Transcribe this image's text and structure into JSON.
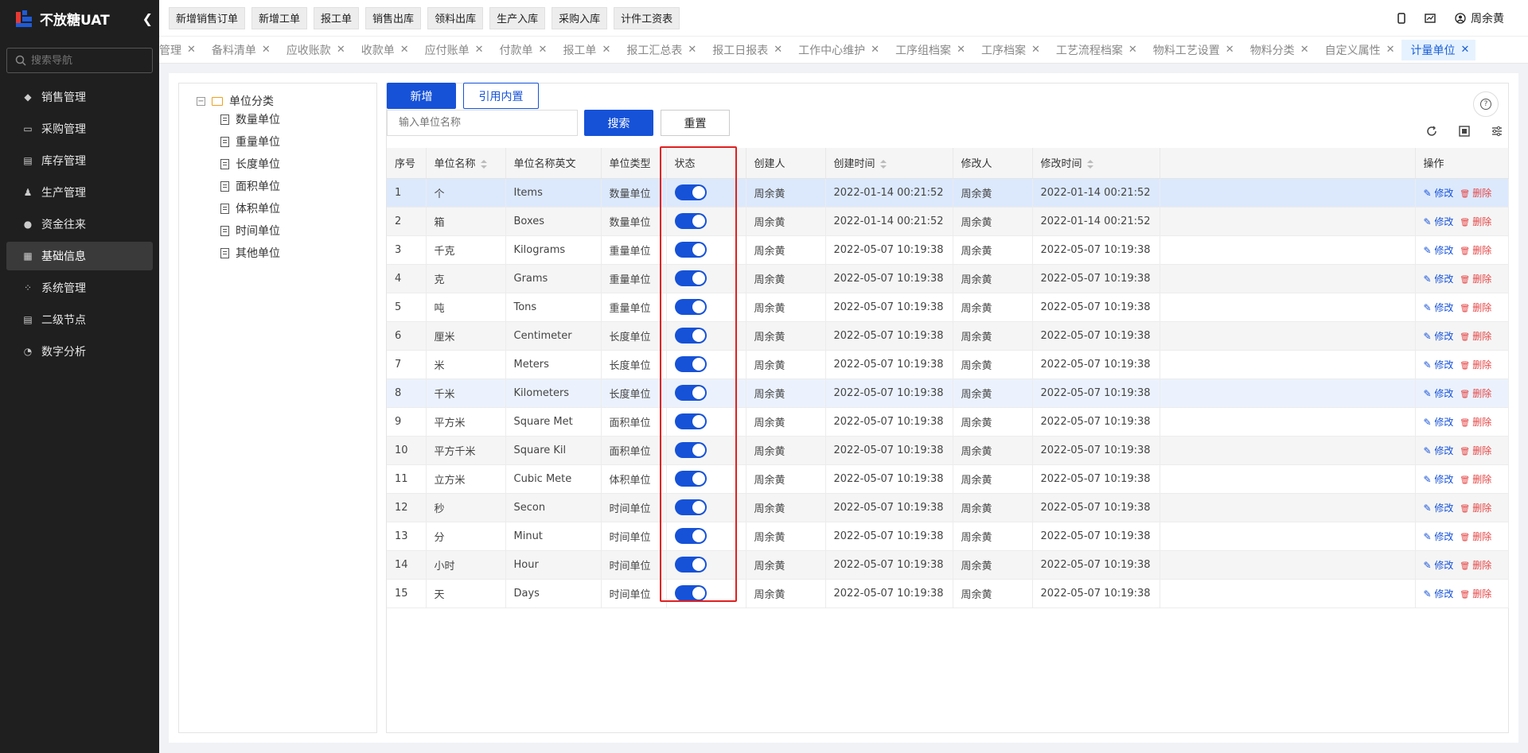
{
  "sidebar": {
    "logo_text": "不放糖UAT",
    "search_placeholder": "搜索导航",
    "items": [
      {
        "label": "销售管理",
        "icon": "tag-icon"
      },
      {
        "label": "采购管理",
        "icon": "cart-icon"
      },
      {
        "label": "库存管理",
        "icon": "warehouse-icon"
      },
      {
        "label": "生产管理",
        "icon": "factory-icon"
      },
      {
        "label": "资金往来",
        "icon": "money-icon"
      },
      {
        "label": "基础信息",
        "icon": "info-icon"
      },
      {
        "label": "系统管理",
        "icon": "apps-icon"
      },
      {
        "label": "二级节点",
        "icon": "list-icon"
      },
      {
        "label": "数字分析",
        "icon": "pie-icon"
      }
    ],
    "active_index": 5
  },
  "topbar": {
    "quick_buttons": [
      "新增销售订单",
      "新增工单",
      "报工单",
      "销售出库",
      "领料出库",
      "生产入库",
      "采购入库",
      "计件工资表"
    ],
    "user_name": "周余黄"
  },
  "tabs": [
    {
      "label": "管理"
    },
    {
      "label": "备料清单"
    },
    {
      "label": "应收账款"
    },
    {
      "label": "收款单"
    },
    {
      "label": "应付账单"
    },
    {
      "label": "付款单"
    },
    {
      "label": "报工单"
    },
    {
      "label": "报工汇总表"
    },
    {
      "label": "报工日报表"
    },
    {
      "label": "工作中心维护"
    },
    {
      "label": "工序组档案"
    },
    {
      "label": "工序档案"
    },
    {
      "label": "工艺流程档案"
    },
    {
      "label": "物料工艺设置"
    },
    {
      "label": "物料分类"
    },
    {
      "label": "自定义属性"
    },
    {
      "label": "计量单位"
    }
  ],
  "tree": {
    "root": "单位分类",
    "children": [
      "数量单位",
      "重量单位",
      "长度单位",
      "面积单位",
      "体积单位",
      "时间单位",
      "其他单位"
    ]
  },
  "toolbar": {
    "add_label": "新增",
    "import_label": "引用内置",
    "search_placeholder": "输入单位名称",
    "search_label": "搜索",
    "reset_label": "重置"
  },
  "table": {
    "headers": [
      "序号",
      "单位名称",
      "单位名称英文",
      "单位类型",
      "状态",
      "创建人",
      "创建时间",
      "修改人",
      "修改时间",
      "",
      "操作"
    ],
    "edit_label": "修改",
    "delete_label": "删除",
    "rows": [
      {
        "no": "1",
        "name": "个",
        "en": "Items",
        "type": "数量单位",
        "creator": "周余黄",
        "created": "2022-01-14 00:21:52",
        "modifier": "周余黄",
        "modified": "2022-01-14 00:21:52",
        "status": true
      },
      {
        "no": "2",
        "name": "箱",
        "en": "Boxes",
        "type": "数量单位",
        "creator": "周余黄",
        "created": "2022-01-14 00:21:52",
        "modifier": "周余黄",
        "modified": "2022-01-14 00:21:52",
        "status": true
      },
      {
        "no": "3",
        "name": "千克",
        "en": "Kilograms",
        "type": "重量单位",
        "creator": "周余黄",
        "created": "2022-05-07 10:19:38",
        "modifier": "周余黄",
        "modified": "2022-05-07 10:19:38",
        "status": true
      },
      {
        "no": "4",
        "name": "克",
        "en": "Grams",
        "type": "重量单位",
        "creator": "周余黄",
        "created": "2022-05-07 10:19:38",
        "modifier": "周余黄",
        "modified": "2022-05-07 10:19:38",
        "status": true
      },
      {
        "no": "5",
        "name": "吨",
        "en": "Tons",
        "type": "重量单位",
        "creator": "周余黄",
        "created": "2022-05-07 10:19:38",
        "modifier": "周余黄",
        "modified": "2022-05-07 10:19:38",
        "status": true
      },
      {
        "no": "6",
        "name": "厘米",
        "en": "Centimeter",
        "type": "长度单位",
        "creator": "周余黄",
        "created": "2022-05-07 10:19:38",
        "modifier": "周余黄",
        "modified": "2022-05-07 10:19:38",
        "status": true
      },
      {
        "no": "7",
        "name": "米",
        "en": "Meters",
        "type": "长度单位",
        "creator": "周余黄",
        "created": "2022-05-07 10:19:38",
        "modifier": "周余黄",
        "modified": "2022-05-07 10:19:38",
        "status": true
      },
      {
        "no": "8",
        "name": "千米",
        "en": "Kilometers",
        "type": "长度单位",
        "creator": "周余黄",
        "created": "2022-05-07 10:19:38",
        "modifier": "周余黄",
        "modified": "2022-05-07 10:19:38",
        "status": true
      },
      {
        "no": "9",
        "name": "平方米",
        "en": "Square Met",
        "type": "面积单位",
        "creator": "周余黄",
        "created": "2022-05-07 10:19:38",
        "modifier": "周余黄",
        "modified": "2022-05-07 10:19:38",
        "status": true
      },
      {
        "no": "10",
        "name": "平方千米",
        "en": "Square Kil",
        "type": "面积单位",
        "creator": "周余黄",
        "created": "2022-05-07 10:19:38",
        "modifier": "周余黄",
        "modified": "2022-05-07 10:19:38",
        "status": true
      },
      {
        "no": "11",
        "name": "立方米",
        "en": "Cubic Mete",
        "type": "体积单位",
        "creator": "周余黄",
        "created": "2022-05-07 10:19:38",
        "modifier": "周余黄",
        "modified": "2022-05-07 10:19:38",
        "status": true
      },
      {
        "no": "12",
        "name": "秒",
        "en": "Secon",
        "type": "时间单位",
        "creator": "周余黄",
        "created": "2022-05-07 10:19:38",
        "modifier": "周余黄",
        "modified": "2022-05-07 10:19:38",
        "status": true
      },
      {
        "no": "13",
        "name": "分",
        "en": "Minut",
        "type": "时间单位",
        "creator": "周余黄",
        "created": "2022-05-07 10:19:38",
        "modifier": "周余黄",
        "modified": "2022-05-07 10:19:38",
        "status": true
      },
      {
        "no": "14",
        "name": "小时",
        "en": "Hour",
        "type": "时间单位",
        "creator": "周余黄",
        "created": "2022-05-07 10:19:38",
        "modifier": "周余黄",
        "modified": "2022-05-07 10:19:38",
        "status": true
      },
      {
        "no": "15",
        "name": "天",
        "en": "Days",
        "type": "时间单位",
        "creator": "周余黄",
        "created": "2022-05-07 10:19:38",
        "modifier": "周余黄",
        "modified": "2022-05-07 10:19:38",
        "status": true
      }
    ]
  },
  "colors": {
    "primary": "#1652d8",
    "danger": "#e54545",
    "highlight_box": "#e02020",
    "sidebar_bg": "#1f1f1f"
  }
}
